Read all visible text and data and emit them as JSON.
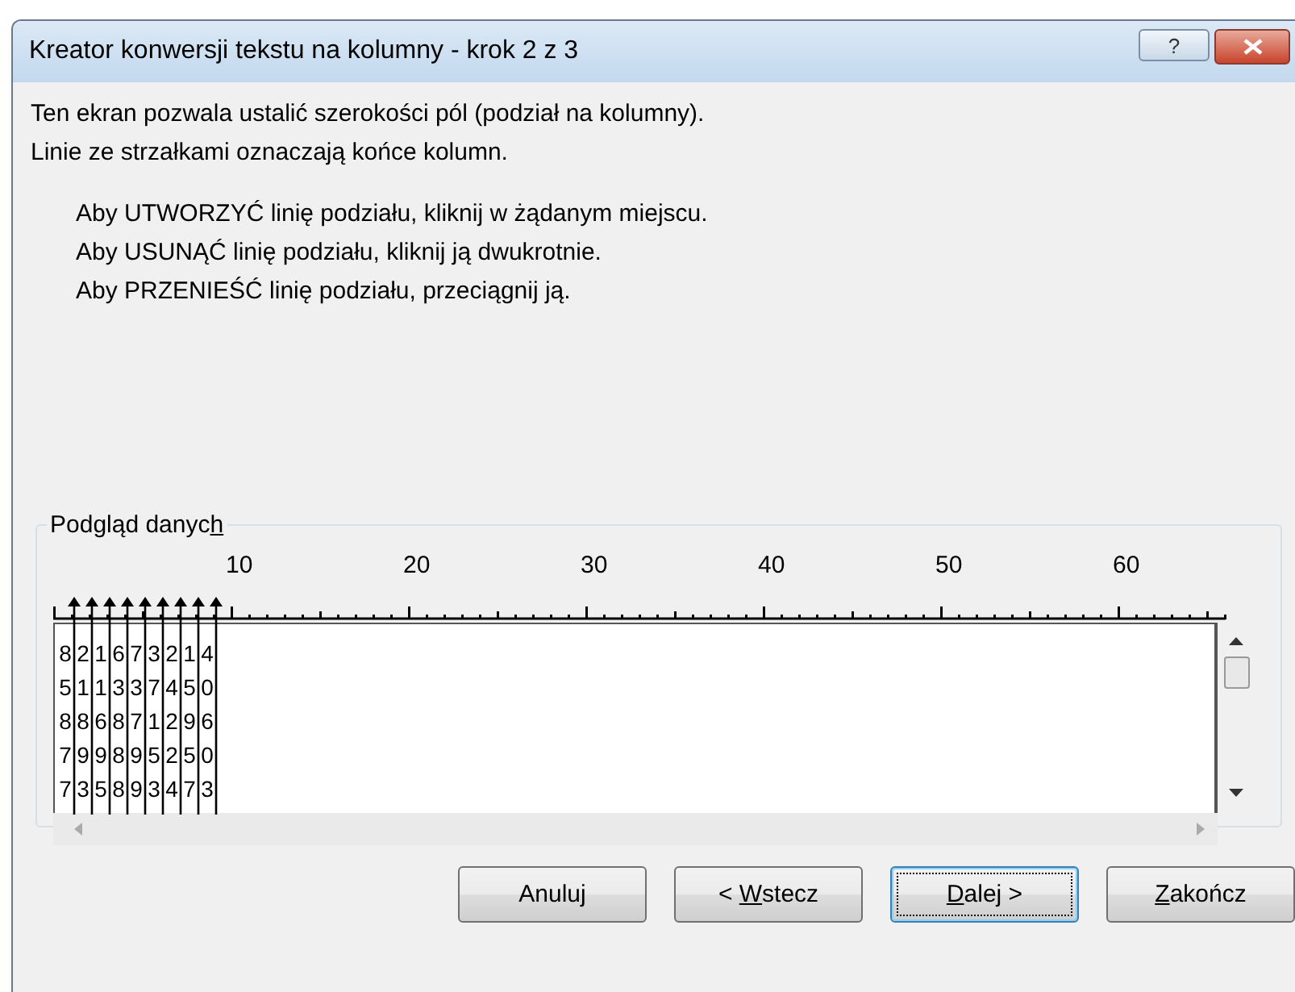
{
  "window": {
    "title": "Kreator konwersji tekstu na kolumny - krok 2 z 3",
    "help": "?"
  },
  "description": [
    "Ten ekran pozwala ustalić szerokości pól (podział na kolumny).",
    "Linie ze strzałkami oznaczają końce kolumn."
  ],
  "instructions": [
    "Aby UTWORZYĆ linię podziału, kliknij w żądanym miejscu.",
    "Aby USUNĄĆ linię podziału, kliknij ją dwukrotnie.",
    "Aby PRZENIEŚĆ linię podziału, przeciągnij ją."
  ],
  "preview": {
    "title_parts": [
      {
        "text": "Podgląd danyc",
        "underline": false
      },
      {
        "text": "h",
        "underline": true
      }
    ],
    "ruler_labels": [
      "10",
      "20",
      "30",
      "40",
      "50",
      "60"
    ],
    "rows": [
      [
        "8",
        "2",
        "1",
        "6",
        "7",
        "3",
        "2",
        "1",
        "4"
      ],
      [
        "5",
        "1",
        "1",
        "3",
        "3",
        "7",
        "4",
        "5",
        "0"
      ],
      [
        "8",
        "8",
        "6",
        "8",
        "7",
        "1",
        "2",
        "9",
        "6"
      ],
      [
        "7",
        "9",
        "9",
        "8",
        "9",
        "5",
        "2",
        "5",
        "0"
      ],
      [
        "7",
        "3",
        "5",
        "8",
        "9",
        "3",
        "4",
        "7",
        "3"
      ]
    ]
  },
  "buttons": [
    {
      "label_parts": [
        {
          "text": "Anuluj",
          "underline": false
        }
      ],
      "default": false
    },
    {
      "label_parts": [
        {
          "text": "< ",
          "underline": false
        },
        {
          "text": "W",
          "underline": true
        },
        {
          "text": "stecz",
          "underline": false
        }
      ],
      "default": false
    },
    {
      "label_parts": [
        {
          "text": "D",
          "underline": true
        },
        {
          "text": "alej >",
          "underline": false
        }
      ],
      "default": true
    },
    {
      "label_parts": [
        {
          "text": "Z",
          "underline": true
        },
        {
          "text": "akończ",
          "underline": false
        }
      ],
      "default": false
    }
  ]
}
